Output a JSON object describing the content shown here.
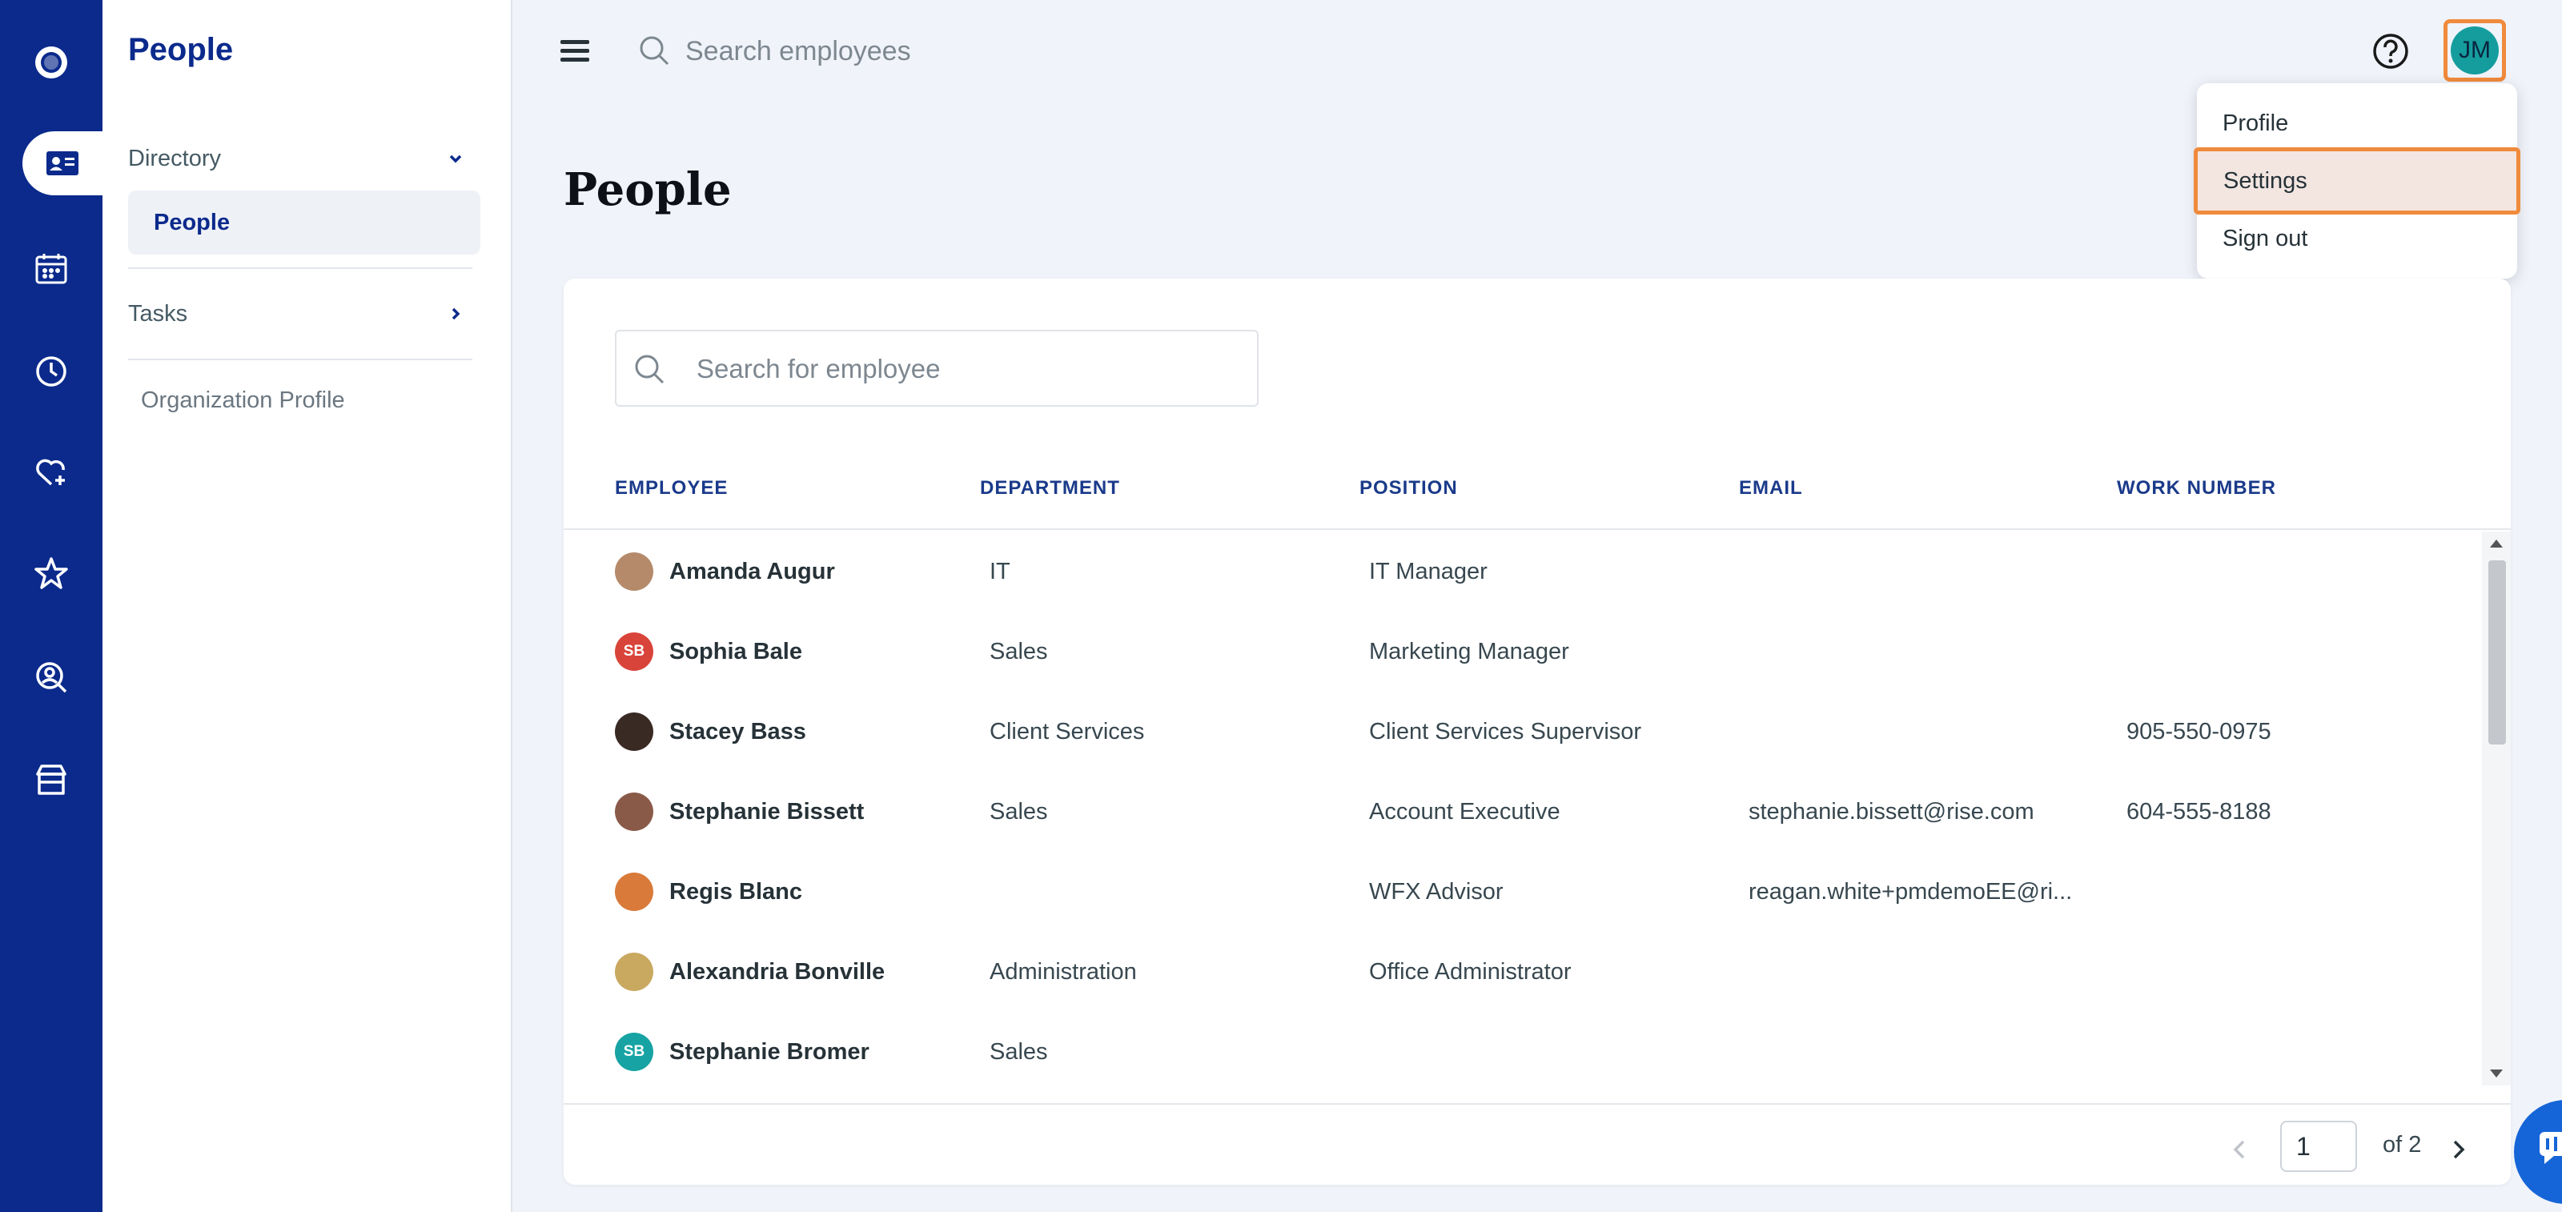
{
  "sidebar": {
    "title": "People",
    "directory_label": "Directory",
    "people_label": "People",
    "tasks_label": "Tasks",
    "org_profile_label": "Organization Profile"
  },
  "rail_icons": [
    "logo-icon",
    "id-card-icon",
    "calendar-icon",
    "clock-icon",
    "heart-plus-icon",
    "star-icon",
    "search-person-icon",
    "store-icon"
  ],
  "topbar": {
    "search_placeholder": "Search employees",
    "avatar_initials": "JM"
  },
  "user_menu": {
    "items": [
      "Profile",
      "Settings",
      "Sign out"
    ],
    "highlighted": "Settings"
  },
  "page_title": "People",
  "table": {
    "search_placeholder": "Search for employee",
    "columns": [
      "EMPLOYEE",
      "DEPARTMENT",
      "POSITION",
      "EMAIL",
      "WORK NUMBER"
    ],
    "rows": [
      {
        "initials": "",
        "avatar_color": "#b58a6a",
        "name": "Amanda Augur",
        "department": "IT",
        "position": "IT Manager",
        "email": "",
        "work_number": ""
      },
      {
        "initials": "SB",
        "avatar_color": "#d9443a",
        "name": "Sophia Bale",
        "department": "Sales",
        "position": "Marketing Manager",
        "email": "",
        "work_number": ""
      },
      {
        "initials": "",
        "avatar_color": "#3a2a24",
        "name": "Stacey Bass",
        "department": "Client Services",
        "position": "Client Services Supervisor",
        "email": "",
        "work_number": "905-550-0975"
      },
      {
        "initials": "",
        "avatar_color": "#8a5a48",
        "name": "Stephanie Bissett",
        "department": "Sales",
        "position": "Account Executive",
        "email": "stephanie.bissett@rise.com",
        "work_number": "604-555-8188"
      },
      {
        "initials": "",
        "avatar_color": "#d97a3a",
        "name": "Regis Blanc",
        "department": "",
        "position": "WFX Advisor",
        "email": "reagan.white+pmdemoEE@ri...",
        "work_number": ""
      },
      {
        "initials": "",
        "avatar_color": "#c9a860",
        "name": "Alexandria Bonville",
        "department": "Administration",
        "position": "Office Administrator",
        "email": "",
        "work_number": ""
      },
      {
        "initials": "SB",
        "avatar_color": "#17a3a3",
        "name": "Stephanie Bromer",
        "department": "Sales",
        "position": "",
        "email": "",
        "work_number": ""
      }
    ]
  },
  "pagination": {
    "current": "1",
    "of_label": "of 2"
  },
  "colors": {
    "rail": "#0b2a8c",
    "accent_highlight": "#f08a3c",
    "avatar": "#159d9d",
    "chat": "#1665d8"
  }
}
